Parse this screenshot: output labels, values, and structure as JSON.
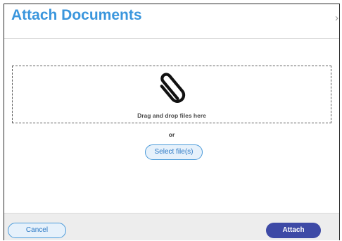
{
  "dialog": {
    "title": "Attach Documents",
    "close_glyph": "›",
    "close_icon": "close-icon"
  },
  "dropzone": {
    "icon": "paperclip-icon",
    "label": "Drag and drop files here"
  },
  "separator": "or",
  "select_button": "Select file(s)",
  "footer": {
    "cancel_label": "Cancel",
    "attach_label": "Attach"
  },
  "colors": {
    "title": "#3a96dd",
    "button_outline": "#4a9ad9",
    "primary_button": "#3e4aa6",
    "footer_background": "#ededed"
  }
}
